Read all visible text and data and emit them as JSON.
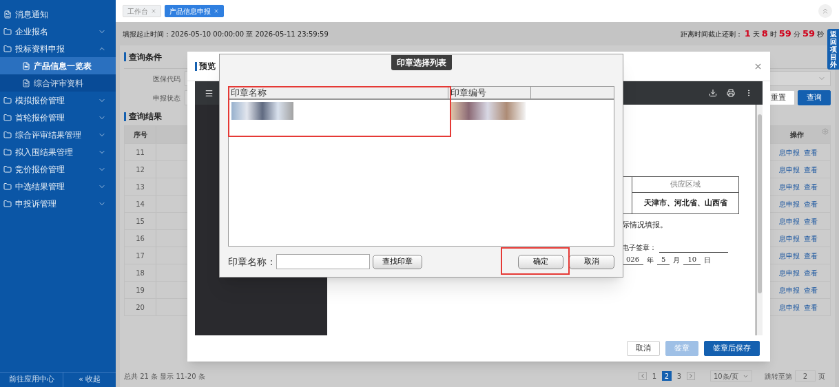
{
  "sidebar": {
    "items": [
      {
        "label": "消息通知",
        "kind": "page",
        "selected": false
      },
      {
        "label": "企业报名",
        "kind": "folder",
        "expanded": false
      },
      {
        "label": "投标资料申报",
        "kind": "folder",
        "expanded": true,
        "children": [
          {
            "label": "产品信息一览表",
            "selected": true
          },
          {
            "label": "综合评审资料",
            "selected": false
          }
        ]
      },
      {
        "label": "模拟报价管理",
        "kind": "folder",
        "expanded": false
      },
      {
        "label": "首轮报价管理",
        "kind": "folder",
        "expanded": false
      },
      {
        "label": "综合评审结果管理",
        "kind": "folder",
        "expanded": false
      },
      {
        "label": "拟入围结果管理",
        "kind": "folder",
        "expanded": false
      },
      {
        "label": "竞价报价管理",
        "kind": "folder",
        "expanded": false
      },
      {
        "label": "中选结果管理",
        "kind": "folder",
        "expanded": false
      },
      {
        "label": "申投诉管理",
        "kind": "folder",
        "expanded": false
      }
    ],
    "footer": {
      "app_center": "前往应用中心",
      "collapse": "« 收起"
    }
  },
  "tabs": [
    {
      "label": "工作台",
      "selected": false
    },
    {
      "label": "产品信息申报",
      "selected": true
    }
  ],
  "period": "填报起止时间：2026-05-10 00:00:00 至 2026-05-11 23:59:59",
  "countdown": {
    "label": "距离时间截止还剩：",
    "parts": [
      {
        "value": "1",
        "unit": "天"
      },
      {
        "value": "8",
        "unit": "时"
      },
      {
        "value": "59",
        "unit": "分"
      },
      {
        "value": "59",
        "unit": "秒"
      }
    ]
  },
  "return_tab": "返回项目外",
  "query": {
    "title": "查询条件",
    "fields": [
      {
        "label": "医保代码"
      },
      {
        "label": "申报状态"
      }
    ],
    "buttons": [
      {
        "label": "重置",
        "kind": "default"
      },
      {
        "label": "查询",
        "kind": "primary"
      }
    ]
  },
  "results": {
    "title": "查询结果",
    "columns": [
      "序号",
      "操作"
    ],
    "rows": [
      {
        "index": "11",
        "actions": [
          "息申报",
          "查看"
        ]
      },
      {
        "index": "12",
        "actions": [
          "息申报",
          "查看"
        ]
      },
      {
        "index": "13",
        "actions": [
          "息申报",
          "查看"
        ]
      },
      {
        "index": "14",
        "actions": [
          "息申报",
          "查看"
        ]
      },
      {
        "index": "15",
        "actions": [
          "息申报",
          "查看"
        ]
      },
      {
        "index": "16",
        "actions": [
          "息申报",
          "查看"
        ]
      },
      {
        "index": "17",
        "actions": [
          "息申报",
          "查看"
        ]
      },
      {
        "index": "18",
        "actions": [
          "息申报",
          "查看"
        ]
      },
      {
        "index": "19",
        "actions": [
          "息申报",
          "查看"
        ]
      },
      {
        "index": "20",
        "actions": [
          "息申报",
          "查看"
        ]
      }
    ]
  },
  "pagination": {
    "summary": "总共 21 条 显示 11-20 条",
    "pages": [
      {
        "label": "1",
        "selected": false
      },
      {
        "label": "2",
        "selected": true
      },
      {
        "label": "3",
        "selected": false
      }
    ],
    "page_size": "10条/页",
    "jump_label": "跳转至第",
    "jump_value": "2",
    "jump_suffix": "页"
  },
  "preview_modal": {
    "title": "预览",
    "document": {
      "table_header": "供应区域",
      "table_cell": "天津市、河北省、山西省",
      "note": "际情况填报。",
      "signature_label": "电子签章：",
      "date_parts": [
        {
          "text": "026",
          "kind": "blank"
        },
        {
          "text": "年",
          "kind": "unit"
        },
        {
          "text": "5",
          "kind": "blank"
        },
        {
          "text": "月",
          "kind": "unit"
        },
        {
          "text": "10",
          "kind": "blank"
        },
        {
          "text": "日",
          "kind": "unit"
        }
      ]
    },
    "buttons": [
      {
        "label": "取消",
        "kind": "default"
      },
      {
        "label": "签章",
        "kind": "disabled"
      },
      {
        "label": "签章后保存",
        "kind": "primary"
      }
    ]
  },
  "seal_dialog": {
    "title": "印章选择列表",
    "columns": [
      "印章名称",
      "印章编号"
    ],
    "search_label": "印章名称：",
    "search_button": "查找印章",
    "buttons": [
      "确定",
      "取消"
    ]
  }
}
